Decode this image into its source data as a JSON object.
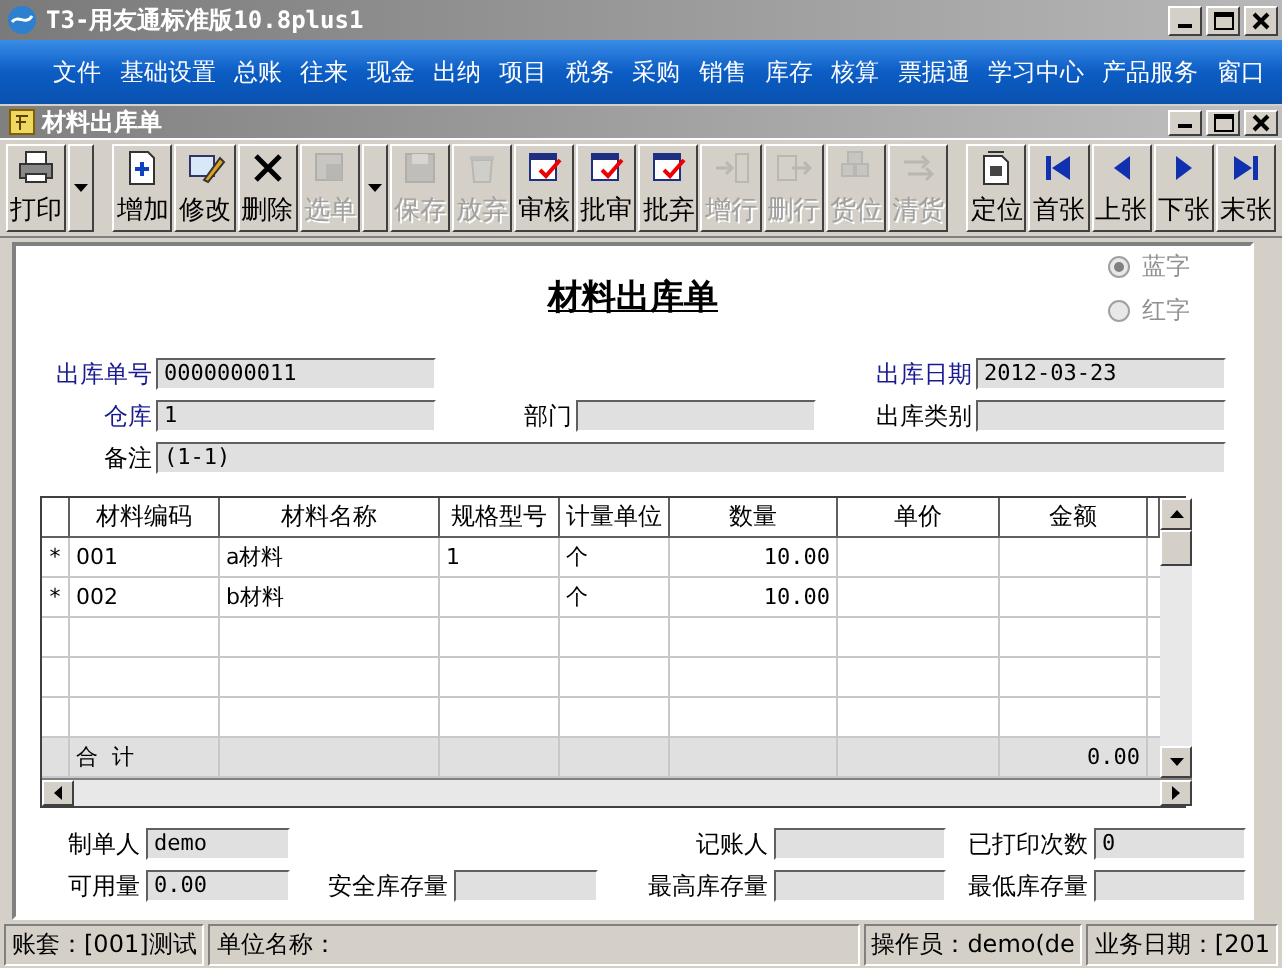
{
  "window": {
    "title": "T3-用友通标准版10.8plus1"
  },
  "menu": [
    "文件",
    "基础设置",
    "总账",
    "往来",
    "现金",
    "出纳",
    "项目",
    "税务",
    "采购",
    "销售",
    "库存",
    "核算",
    "票据通",
    "学习中心",
    "产品服务",
    "窗口"
  ],
  "document_window": {
    "title": "材料出库单"
  },
  "toolbar": [
    {
      "kind": "button",
      "label": "打印",
      "disabled": false
    },
    {
      "kind": "dropdown"
    },
    {
      "kind": "button",
      "label": "增加",
      "disabled": false
    },
    {
      "kind": "button",
      "label": "修改",
      "disabled": false
    },
    {
      "kind": "button",
      "label": "删除",
      "disabled": false
    },
    {
      "kind": "button",
      "label": "选单",
      "disabled": true
    },
    {
      "kind": "dropdown"
    },
    {
      "kind": "button",
      "label": "保存",
      "disabled": true
    },
    {
      "kind": "button",
      "label": "放弃",
      "disabled": true
    },
    {
      "kind": "button",
      "label": "审核",
      "disabled": false
    },
    {
      "kind": "button",
      "label": "批审",
      "disabled": false
    },
    {
      "kind": "button",
      "label": "批弃",
      "disabled": false
    },
    {
      "kind": "button",
      "label": "增行",
      "disabled": true
    },
    {
      "kind": "button",
      "label": "删行",
      "disabled": true
    },
    {
      "kind": "button",
      "label": "货位",
      "disabled": true
    },
    {
      "kind": "button",
      "label": "清货",
      "disabled": true
    },
    {
      "kind": "button",
      "label": "定位",
      "disabled": false
    },
    {
      "kind": "button",
      "label": "首张",
      "disabled": false
    },
    {
      "kind": "button",
      "label": "上张",
      "disabled": false
    },
    {
      "kind": "button",
      "label": "下张",
      "disabled": false
    },
    {
      "kind": "button",
      "label": "末张",
      "disabled": false
    }
  ],
  "form": {
    "title": "材料出库单",
    "color_options": [
      {
        "label": "蓝字",
        "selected": true
      },
      {
        "label": "红字",
        "selected": false
      }
    ],
    "fields": [
      {
        "label": "出库单号",
        "value": "0000000011",
        "required": true
      },
      {
        "label": "出库日期",
        "value": "2012-03-23",
        "required": true
      },
      {
        "label": "仓库",
        "value": "1",
        "required": true
      },
      {
        "label": "部门",
        "required": false
      },
      {
        "label": "出库类别",
        "required": false
      },
      {
        "label": "备注",
        "value": "(1-1)",
        "required": false
      }
    ]
  },
  "table": {
    "columns": [
      "材料编码",
      "材料名称",
      "规格型号",
      "计量单位",
      "数量",
      "单价",
      "金额"
    ],
    "rows": [
      {
        "marker": "*",
        "code": "001",
        "name": "a材料",
        "spec": "1",
        "unit": "个",
        "quantity": "10.00"
      },
      {
        "marker": "*",
        "code": "002",
        "name": "b材料",
        "unit": "个",
        "quantity": "10.00"
      }
    ],
    "total_row": {
      "label": "合  计",
      "amount": "0.00"
    }
  },
  "footer_fields": [
    {
      "label": "制单人",
      "value": "demo"
    },
    {
      "label": "记账人"
    },
    {
      "label": "已打印次数",
      "value": "0"
    },
    {
      "label": "可用量",
      "value": "0.00"
    },
    {
      "label": "安全库存量"
    },
    {
      "label": "最高库存量"
    },
    {
      "label": "最低库存量"
    }
  ],
  "status_bar": [
    "账套：[001]测试",
    "单位名称：",
    "操作员：demo(de",
    "业务日期：[201"
  ]
}
